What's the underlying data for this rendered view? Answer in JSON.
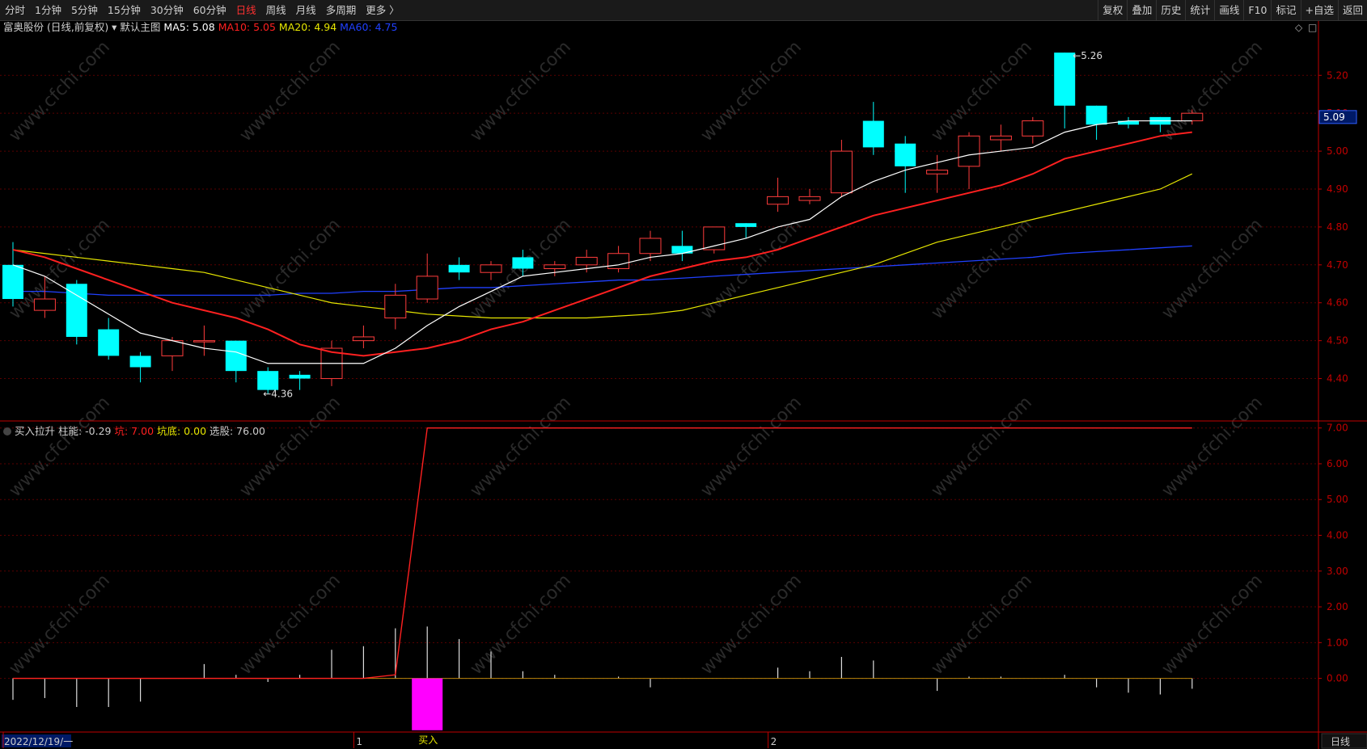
{
  "toolbar": {
    "periods": [
      "分时",
      "1分钟",
      "5分钟",
      "15分钟",
      "30分钟",
      "60分钟",
      "日线",
      "周线",
      "月线",
      "多周期",
      "更多 〉"
    ],
    "active_period": "日线",
    "tools": [
      "复权",
      "叠加",
      "历史",
      "统计",
      "画线",
      "F10",
      "标记",
      "+自选",
      "返回"
    ]
  },
  "main_legend": {
    "stock": "富奥股份 (日线,前复权)",
    "template": "默认主图",
    "ma": [
      {
        "label": "MA5: 5.08",
        "color": "#ffffff"
      },
      {
        "label": "MA10: 5.05",
        "color": "#ff2020"
      },
      {
        "label": "MA20: 4.94",
        "color": "#e6e600"
      },
      {
        "label": "MA60: 4.75",
        "color": "#2040ff"
      }
    ]
  },
  "sub_legend": {
    "name": "买入拉升",
    "items": [
      {
        "label": "柱能: -0.29",
        "color": "#cccccc"
      },
      {
        "label": "坑: 7.00",
        "color": "#ff2020"
      },
      {
        "label": "坑底: 0.00",
        "color": "#e6e600"
      },
      {
        "label": "选股: 76.00",
        "color": "#cccccc"
      }
    ]
  },
  "colors": {
    "up": "#ff3c3c",
    "down": "#00ffff",
    "ma5": "#ffffff",
    "ma10": "#ff2020",
    "ma20": "#e6e600",
    "ma60": "#2040ff",
    "axis": "#c00000",
    "buy_bar": "#ff00ff"
  },
  "watermark": "www.cfchi.com",
  "chart_data": [
    {
      "type": "candlestick",
      "title": "富奥股份 (日线,前复权)",
      "y_ticks": [
        "5.20",
        "5.10",
        "5.00",
        "4.90",
        "4.80",
        "4.70",
        "4.60",
        "4.50",
        "4.40"
      ],
      "ylim": [
        4.35,
        5.305
      ],
      "current_price_label": "5.09",
      "high_annotation": "5.26",
      "low_annotation": "4.36",
      "x_date_labels": [
        "2022/12/19/一",
        "1",
        "2"
      ],
      "candles": [
        {
          "o": 4.7,
          "h": 4.76,
          "l": 4.59,
          "c": 4.61
        },
        {
          "o": 4.58,
          "h": 4.67,
          "l": 4.56,
          "c": 4.61
        },
        {
          "o": 4.65,
          "h": 4.66,
          "l": 4.49,
          "c": 4.51
        },
        {
          "o": 4.53,
          "h": 4.56,
          "l": 4.45,
          "c": 4.46
        },
        {
          "o": 4.46,
          "h": 4.47,
          "l": 4.39,
          "c": 4.43
        },
        {
          "o": 4.46,
          "h": 4.51,
          "l": 4.42,
          "c": 4.5
        },
        {
          "o": 4.5,
          "h": 4.54,
          "l": 4.46,
          "c": 4.5
        },
        {
          "o": 4.5,
          "h": 4.5,
          "l": 4.39,
          "c": 4.42
        },
        {
          "o": 4.42,
          "h": 4.43,
          "l": 4.36,
          "c": 4.37
        },
        {
          "o": 4.41,
          "h": 4.42,
          "l": 4.37,
          "c": 4.4
        },
        {
          "o": 4.4,
          "h": 4.5,
          "l": 4.38,
          "c": 4.48
        },
        {
          "o": 4.5,
          "h": 4.54,
          "l": 4.48,
          "c": 4.51
        },
        {
          "o": 4.56,
          "h": 4.65,
          "l": 4.53,
          "c": 4.62
        },
        {
          "o": 4.61,
          "h": 4.73,
          "l": 4.6,
          "c": 4.67
        },
        {
          "o": 4.7,
          "h": 4.72,
          "l": 4.66,
          "c": 4.68
        },
        {
          "o": 4.68,
          "h": 4.71,
          "l": 4.66,
          "c": 4.7
        },
        {
          "o": 4.72,
          "h": 4.74,
          "l": 4.67,
          "c": 4.69
        },
        {
          "o": 4.69,
          "h": 4.71,
          "l": 4.67,
          "c": 4.7
        },
        {
          "o": 4.7,
          "h": 4.74,
          "l": 4.68,
          "c": 4.72
        },
        {
          "o": 4.69,
          "h": 4.75,
          "l": 4.68,
          "c": 4.73
        },
        {
          "o": 4.73,
          "h": 4.79,
          "l": 4.71,
          "c": 4.77
        },
        {
          "o": 4.75,
          "h": 4.79,
          "l": 4.71,
          "c": 4.73
        },
        {
          "o": 4.74,
          "h": 4.8,
          "l": 4.73,
          "c": 4.8
        },
        {
          "o": 4.81,
          "h": 4.81,
          "l": 4.77,
          "c": 4.8
        },
        {
          "o": 4.86,
          "h": 4.93,
          "l": 4.84,
          "c": 4.88
        },
        {
          "o": 4.87,
          "h": 4.9,
          "l": 4.86,
          "c": 4.88
        },
        {
          "o": 4.89,
          "h": 5.03,
          "l": 4.88,
          "c": 5.0
        },
        {
          "o": 5.08,
          "h": 5.13,
          "l": 4.99,
          "c": 5.01
        },
        {
          "o": 5.02,
          "h": 5.04,
          "l": 4.89,
          "c": 4.96
        },
        {
          "o": 4.94,
          "h": 4.99,
          "l": 4.89,
          "c": 4.95
        },
        {
          "o": 4.96,
          "h": 5.05,
          "l": 4.9,
          "c": 5.04
        },
        {
          "o": 5.03,
          "h": 5.07,
          "l": 5.0,
          "c": 5.04
        },
        {
          "o": 5.04,
          "h": 5.09,
          "l": 5.02,
          "c": 5.08
        },
        {
          "o": 5.26,
          "h": 5.26,
          "l": 5.06,
          "c": 5.12
        },
        {
          "o": 5.12,
          "h": 5.12,
          "l": 5.03,
          "c": 5.07
        },
        {
          "o": 5.08,
          "h": 5.09,
          "l": 5.06,
          "c": 5.07
        },
        {
          "o": 5.09,
          "h": 5.09,
          "l": 5.05,
          "c": 5.07
        },
        {
          "o": 5.08,
          "h": 5.11,
          "l": 5.07,
          "c": 5.1
        }
      ],
      "ma5": [
        4.7,
        4.67,
        4.62,
        4.57,
        4.52,
        4.5,
        4.48,
        4.47,
        4.44,
        4.44,
        4.44,
        4.44,
        4.48,
        4.54,
        4.59,
        4.63,
        4.67,
        4.68,
        4.69,
        4.7,
        4.72,
        4.73,
        4.75,
        4.77,
        4.8,
        4.82,
        4.88,
        4.92,
        4.95,
        4.97,
        4.99,
        5.0,
        5.01,
        5.05,
        5.07,
        5.08,
        5.08,
        5.08
      ],
      "ma10": [
        4.74,
        4.72,
        4.69,
        4.66,
        4.63,
        4.6,
        4.58,
        4.56,
        4.53,
        4.49,
        4.47,
        4.46,
        4.47,
        4.48,
        4.5,
        4.53,
        4.55,
        4.58,
        4.61,
        4.64,
        4.67,
        4.69,
        4.71,
        4.72,
        4.74,
        4.77,
        4.8,
        4.83,
        4.85,
        4.87,
        4.89,
        4.91,
        4.94,
        4.98,
        5.0,
        5.02,
        5.04,
        5.05
      ],
      "ma20": [
        4.74,
        4.73,
        4.72,
        4.71,
        4.7,
        4.69,
        4.68,
        4.66,
        4.64,
        4.62,
        4.6,
        4.59,
        4.58,
        4.57,
        4.565,
        4.56,
        4.56,
        4.56,
        4.56,
        4.565,
        4.57,
        4.58,
        4.6,
        4.62,
        4.64,
        4.66,
        4.68,
        4.7,
        4.73,
        4.76,
        4.78,
        4.8,
        4.82,
        4.84,
        4.86,
        4.88,
        4.9,
        4.94
      ],
      "ma60": [
        4.63,
        4.63,
        4.625,
        4.62,
        4.62,
        4.62,
        4.62,
        4.62,
        4.62,
        4.625,
        4.625,
        4.63,
        4.63,
        4.635,
        4.64,
        4.64,
        4.645,
        4.65,
        4.655,
        4.66,
        4.66,
        4.665,
        4.67,
        4.675,
        4.68,
        4.685,
        4.69,
        4.695,
        4.7,
        4.705,
        4.71,
        4.715,
        4.72,
        4.73,
        4.735,
        4.74,
        4.745,
        4.75
      ]
    },
    {
      "type": "bar",
      "title": "买入拉升",
      "y_ticks": [
        "7.00",
        "6.00",
        "5.00",
        "4.00",
        "3.00",
        "2.00",
        "1.00",
        "0.00"
      ],
      "ylim": [
        -1.5,
        7.4
      ],
      "buy_label": "买入",
      "buy_index": 13,
      "buy_value": -1.45,
      "bars": [
        -0.6,
        -0.55,
        -0.8,
        -0.8,
        -0.65,
        0.0,
        0.4,
        0.1,
        -0.1,
        0.1,
        0.8,
        0.9,
        1.4,
        1.45,
        1.1,
        0.75,
        0.2,
        0.1,
        0.0,
        0.05,
        -0.25,
        0.0,
        0.0,
        0.0,
        0.3,
        0.2,
        0.6,
        0.5,
        0.0,
        -0.35,
        0.05,
        0.05,
        0.0,
        0.1,
        -0.25,
        -0.4,
        -0.45,
        -0.29
      ],
      "kang_line": [
        0,
        0,
        0,
        0,
        0,
        0,
        0,
        0,
        0,
        0,
        0,
        0,
        0.1,
        7,
        7,
        7,
        7,
        7,
        7,
        7,
        7,
        7,
        7,
        7,
        7,
        7,
        7,
        7,
        7,
        7,
        7,
        7,
        7,
        7,
        7,
        7,
        7,
        7
      ]
    }
  ]
}
